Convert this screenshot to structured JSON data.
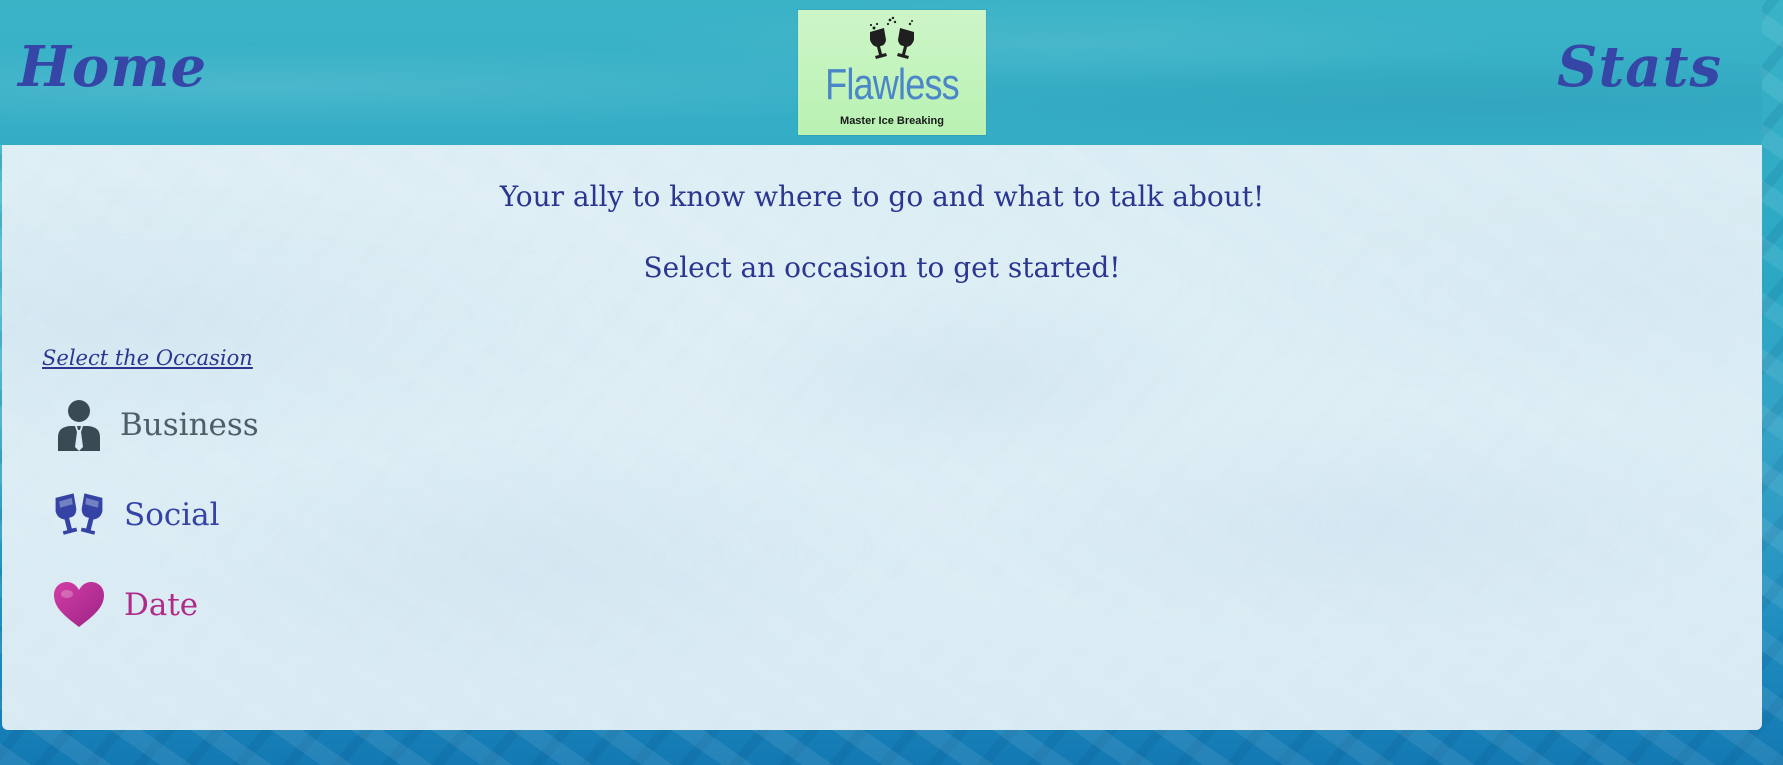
{
  "header": {
    "home_label": "Home",
    "stats_label": "Stats",
    "logo": {
      "name": "Flawless",
      "tagline": "Master Ice Breaking"
    }
  },
  "main": {
    "tagline_1": "Your ally to know where to go and what to talk about!",
    "tagline_2": "Select an occasion to get started!",
    "occasion_heading": "Select the Occasion",
    "occasions": [
      {
        "label": "Business",
        "icon": "businessman-icon",
        "color": "#4f5e66"
      },
      {
        "label": "Social",
        "icon": "toasting-glasses-icon",
        "color": "#3544a4"
      },
      {
        "label": "Date",
        "icon": "heart-icon",
        "color": "#b02a8a"
      }
    ]
  },
  "colors": {
    "nav_text": "#3546a6",
    "header_bg": "#3bb3c7",
    "body_text": "#2a3690",
    "logo_bg": "#c6f4c0",
    "logo_text": "#4a86c8"
  }
}
